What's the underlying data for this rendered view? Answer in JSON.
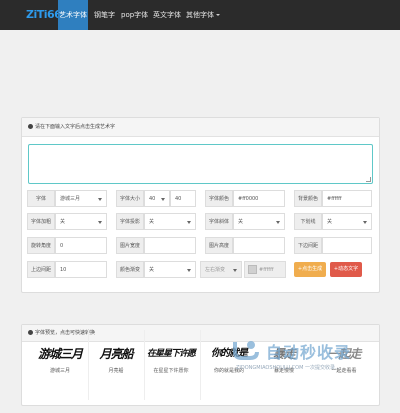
{
  "nav": {
    "logo": "ZiTi66",
    "items": [
      {
        "label": "艺术字体"
      },
      {
        "label": "钢笔字"
      },
      {
        "label": "pop字体"
      },
      {
        "label": "英文字体"
      },
      {
        "label": "其他字体"
      }
    ]
  },
  "form": {
    "prompt": "请在下面输入文字后点击生成艺术字",
    "text_value": "",
    "font": {
      "label": "字体",
      "value": "游城三月"
    },
    "size": {
      "label": "字体大小",
      "value1": "40",
      "value2": "40"
    },
    "color": {
      "label": "字体颜色",
      "value": "#ff0000"
    },
    "bgcolor": {
      "label": "背景颜色",
      "value": "#ffffff"
    },
    "bold": {
      "label": "字体加粗",
      "value": "关"
    },
    "shadow": {
      "label": "字体投影",
      "value": "关"
    },
    "italic": {
      "label": "字体斜体",
      "value": "关"
    },
    "underline": {
      "label": "下划线",
      "value": "关"
    },
    "rotate": {
      "label": "旋转角度",
      "value": "0"
    },
    "width": {
      "label": "图片宽度",
      "value": ""
    },
    "height": {
      "label": "图片高度",
      "value": ""
    },
    "bottom": {
      "label": "下边间距",
      "value": ""
    },
    "top": {
      "label": "上边间距",
      "value": "10"
    },
    "gradient": {
      "label": "颜色渐变",
      "value": "关",
      "dir": "左右渐变",
      "color": "#ffffff"
    },
    "btn_generate": "点击生成",
    "btn_animated": "动态文字"
  },
  "preview": {
    "header": "字体预览，点击可快速转换",
    "cards": [
      {
        "art": "游城三月",
        "name": "游城三月"
      },
      {
        "art": "月亮船",
        "name": "月亮船"
      },
      {
        "art": "在星星下许愿",
        "name": "在星星下许愿你"
      },
      {
        "art": "你的就是",
        "name": "你的就是我的"
      },
      {
        "art": "暴走",
        "name": "暴走慢慢"
      },
      {
        "art": "一起走",
        "name": "一起走看看"
      }
    ]
  },
  "watermark": {
    "title": "自动秒收录",
    "sub": "ZIDONGMIAOSHOULU.COM 一次提交收录…"
  },
  "colors": {
    "nav_bg": "#2b2b2b",
    "nav_active": "#2f7fbf",
    "logo": "#2e9aeb",
    "btn_generate": "#f0ad4e",
    "btn_animated": "#e05a4a"
  }
}
